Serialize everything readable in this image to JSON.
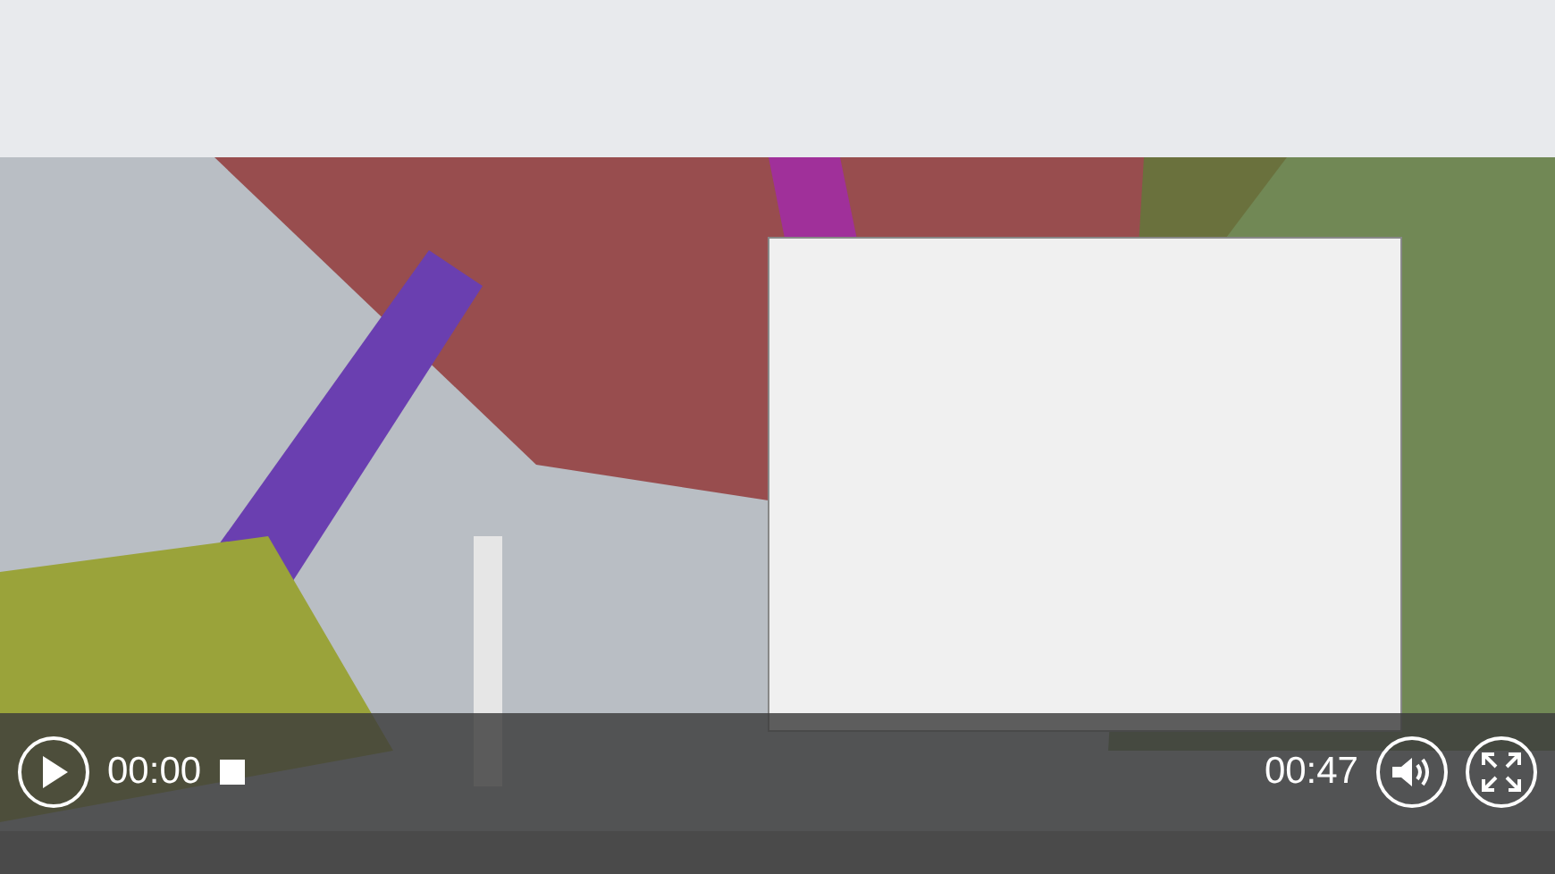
{
  "player": {
    "playing": false,
    "current_time": "00:00",
    "duration": "00:47"
  }
}
